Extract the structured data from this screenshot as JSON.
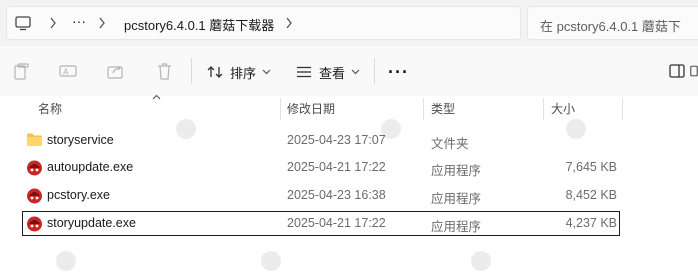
{
  "address_bar": {
    "crumb_more": "···",
    "crumb_folder": "pcstory6.4.0.1 蘑菇下载器",
    "search_placeholder": "在 pcstory6.4.0.1 蘑菇下"
  },
  "command_bar": {
    "sort_label": "排序",
    "view_label": "查看",
    "more_label": "···"
  },
  "columns": {
    "name": "名称",
    "modified": "修改日期",
    "type": "类型",
    "size": "大小"
  },
  "files": [
    {
      "name": "storyservice",
      "modified": "2025-04-23 17:07",
      "type": "文件夹",
      "size": "",
      "icon": "folder-icon",
      "selected": false
    },
    {
      "name": "autoupdate.exe",
      "modified": "2025-04-21 17:22",
      "type": "应用程序",
      "size": "7,645 KB",
      "icon": "app-icon",
      "selected": false
    },
    {
      "name": "pcstory.exe",
      "modified": "2025-04-23 16:38",
      "type": "应用程序",
      "size": "8,452 KB",
      "icon": "app-icon",
      "selected": false
    },
    {
      "name": "storyupdate.exe",
      "modified": "2025-04-21 17:22",
      "type": "应用程序",
      "size": "4,237 KB",
      "icon": "app-icon",
      "selected": true
    }
  ],
  "colors": {
    "folder": "#f4c24d",
    "app_icon_red": "#c62828",
    "selection_border": "#1f1f1f"
  }
}
